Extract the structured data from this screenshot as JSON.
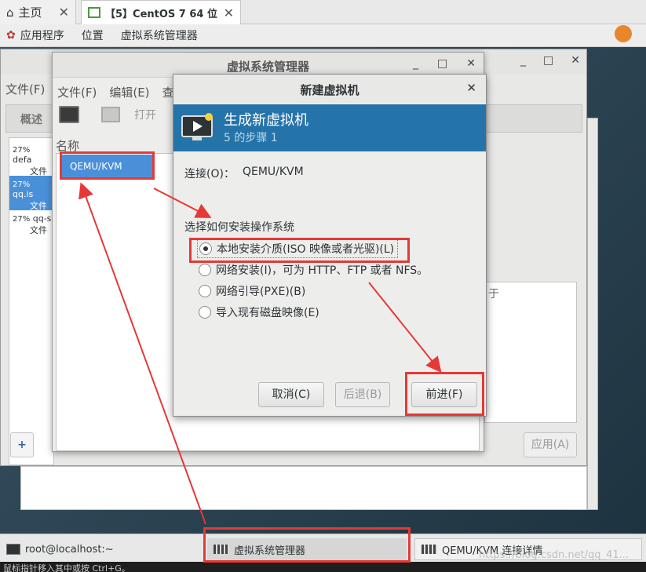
{
  "browser_tabs": {
    "home": {
      "label": "主页"
    },
    "vm": {
      "label": "【5】CentOS 7 64 位"
    }
  },
  "panel": {
    "applications": "应用程序",
    "places": "位置",
    "app_name": "虚拟系统管理器"
  },
  "back_window": {
    "menu": "文件(F)",
    "tab_overview": "概述",
    "right_pane_text": "于",
    "apply": "应用(A)",
    "vms": [
      {
        "pct": "27%",
        "name": "defa",
        "sub": "文件"
      },
      {
        "pct": "27%",
        "name": "qq.is",
        "sub": "文件"
      },
      {
        "pct": "27%",
        "name": "qq-s",
        "sub": "文件"
      }
    ]
  },
  "manager": {
    "title": "虚拟系统管理器",
    "menu": [
      "文件(F)",
      "编辑(E)",
      "查"
    ],
    "open": "打开",
    "column_name": "名称",
    "connection": "QEMU/KVM"
  },
  "dialog": {
    "title": "新建虚拟机",
    "header_title": "生成新虚拟机",
    "header_sub": "5 的步骤 1",
    "connection_label": "连接(O)：",
    "connection_value": "QEMU/KVM",
    "prompt": "选择如何安装操作系统",
    "options": [
      {
        "label": "本地安装介质(ISO 映像或者光驱)(L)",
        "selected": true
      },
      {
        "label": "网络安装(I)，可为 HTTP、FTP 或者 NFS。",
        "selected": false
      },
      {
        "label": "网络引导(PXE)(B)",
        "selected": false
      },
      {
        "label": "导入现有磁盘映像(E)",
        "selected": false
      }
    ],
    "cancel": "取消(C)",
    "back": "后退(B)",
    "forward": "前进(F)"
  },
  "taskbar": {
    "terminal": "root@localhost:~",
    "manager": "虚拟系统管理器",
    "details": "QEMU/KVM 连接详情"
  },
  "footer_text": "鼠标指针移入其中或按 Ctrl+G。",
  "watermark": "https://blog.csdn.net/qq_41...",
  "colors": {
    "header": "#2574a9",
    "selection": "#4a90d9",
    "annotation": "#e53935"
  }
}
